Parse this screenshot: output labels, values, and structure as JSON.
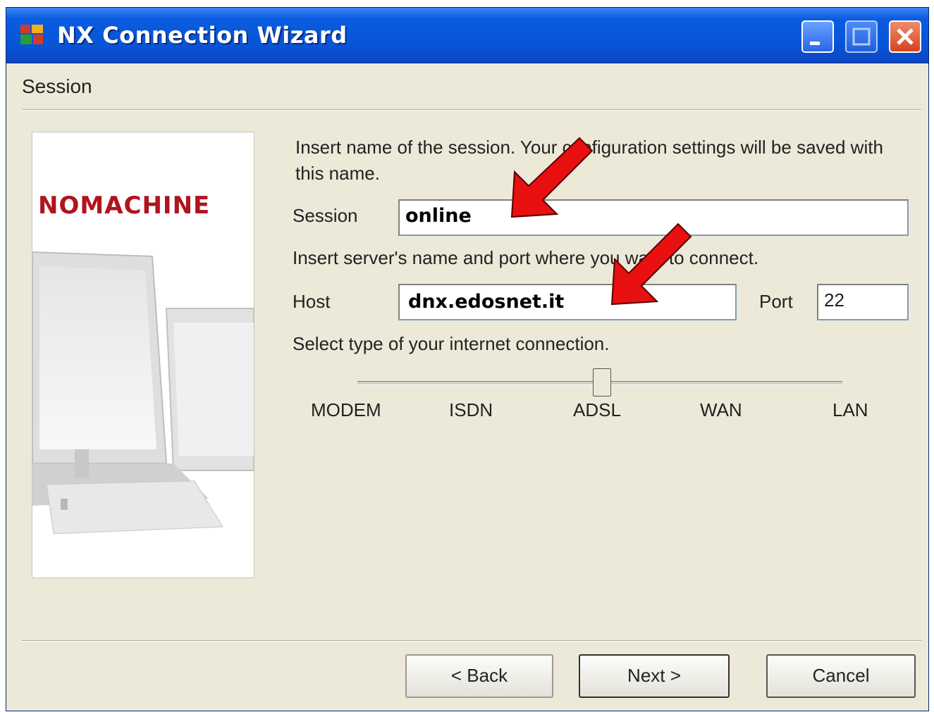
{
  "window": {
    "title": "NX Connection Wizard"
  },
  "section": {
    "title": "Session"
  },
  "brand": {
    "name": "NOMACHINE"
  },
  "session": {
    "instruction": "Insert name of the session. Your configuration settings will be saved with this name.",
    "label": "Session",
    "value": "online"
  },
  "server": {
    "instruction": "Insert server's name and port where you want to connect.",
    "host_label": "Host",
    "host_value": "dnx.edosnet.it",
    "port_label": "Port",
    "port_value": "22"
  },
  "connection": {
    "instruction": "Select type of your internet connection.",
    "options": [
      "MODEM",
      "ISDN",
      "ADSL",
      "WAN",
      "LAN"
    ],
    "selected": "ADSL"
  },
  "buttons": {
    "back": "Back",
    "next": "Next",
    "cancel": "Cancel"
  },
  "annotation_color": "#e81010",
  "title_bar_color": "#0754d6"
}
